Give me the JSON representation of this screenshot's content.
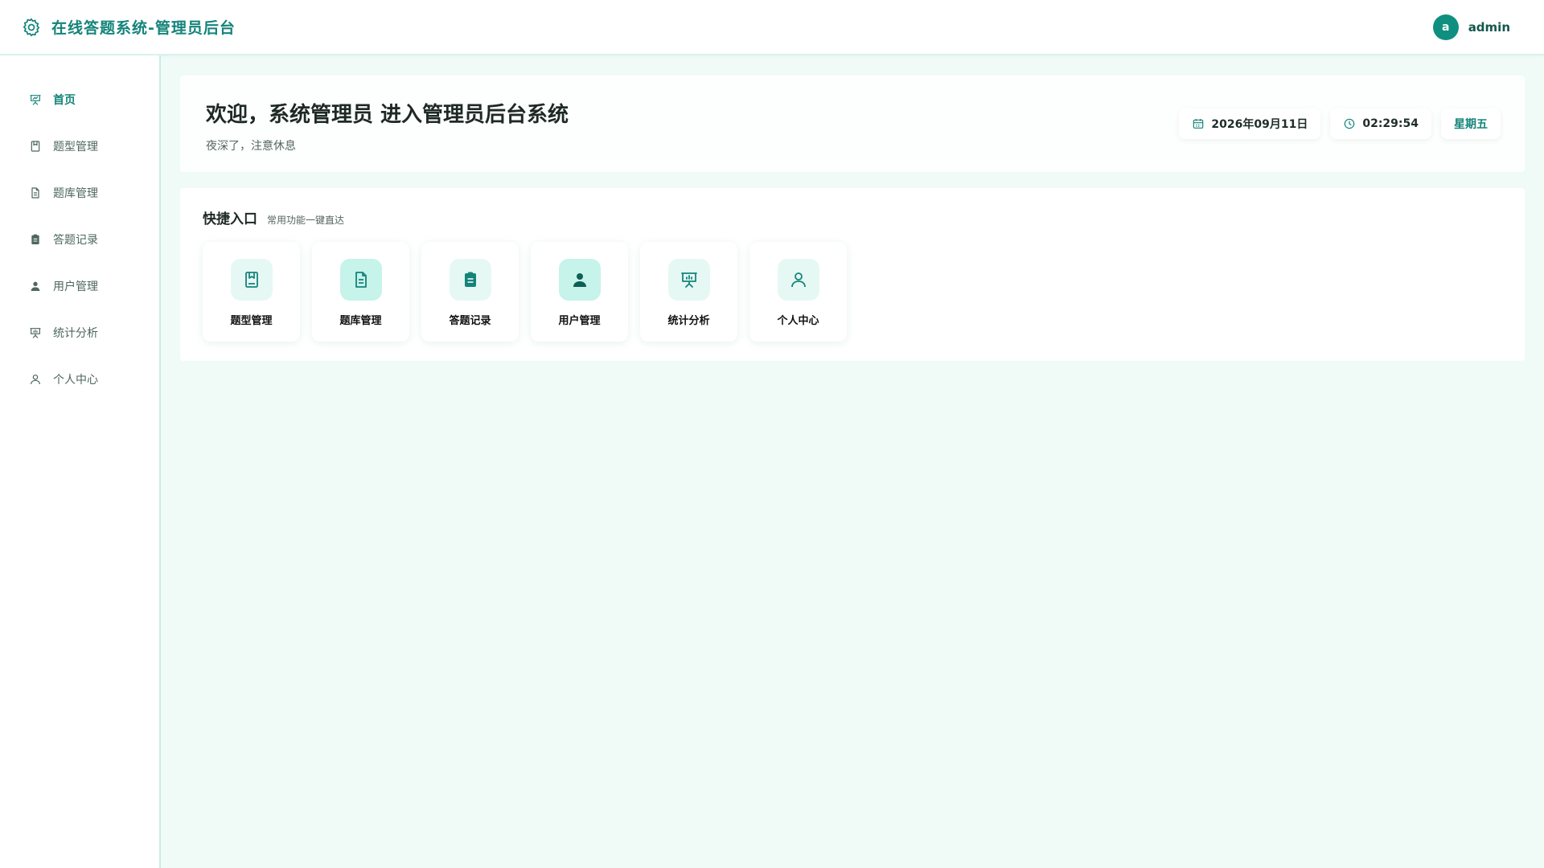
{
  "header": {
    "title": "在线答题系统-管理员后台",
    "icon": "gear-icon",
    "user": {
      "avatar_letter": "a",
      "name": "admin"
    }
  },
  "sidebar": {
    "items": [
      {
        "label": "首页",
        "icon": "presentation-chart-icon",
        "active": true
      },
      {
        "label": "题型管理",
        "icon": "bookmark-book-icon",
        "active": false
      },
      {
        "label": "题库管理",
        "icon": "document-icon",
        "active": false
      },
      {
        "label": "答题记录",
        "icon": "clipboard-icon",
        "active": false
      },
      {
        "label": "用户管理",
        "icon": "user-filled-icon",
        "active": false
      },
      {
        "label": "统计分析",
        "icon": "presentation-chart-icon",
        "active": false
      },
      {
        "label": "个人中心",
        "icon": "user-outline-icon",
        "active": false
      }
    ]
  },
  "welcome": {
    "title": "欢迎，系统管理员 进入管理员后台系统",
    "subtitle": "夜深了，注意休息",
    "date": "2026年09月11日",
    "time": "02:29:54",
    "weekday": "星期五"
  },
  "quick": {
    "title": "快捷入口",
    "subtitle": "常用功能一键直达",
    "items": [
      {
        "label": "题型管理",
        "icon": "bookmark-book-icon"
      },
      {
        "label": "题库管理",
        "icon": "document-icon"
      },
      {
        "label": "答题记录",
        "icon": "clipboard-icon"
      },
      {
        "label": "用户管理",
        "icon": "user-filled-icon"
      },
      {
        "label": "统计分析",
        "icon": "presentation-chart-icon"
      },
      {
        "label": "个人中心",
        "icon": "user-outline-icon"
      }
    ]
  },
  "colors": {
    "accent": "#14847a",
    "background": "#f0fbf8",
    "avatar": "#0f8f7f"
  }
}
